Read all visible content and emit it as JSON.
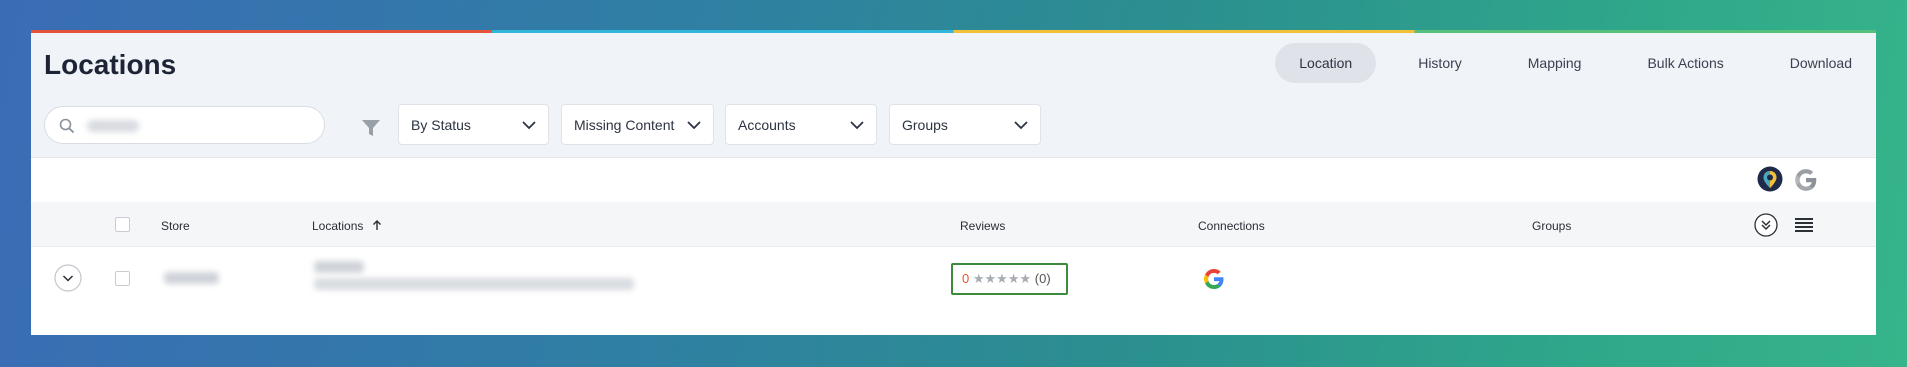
{
  "page": {
    "title": "Locations"
  },
  "nav": {
    "items": [
      {
        "label": "Location",
        "active": true
      },
      {
        "label": "History",
        "active": false
      },
      {
        "label": "Mapping",
        "active": false
      },
      {
        "label": "Bulk Actions",
        "active": false
      },
      {
        "label": "Download",
        "active": false
      }
    ]
  },
  "filters": {
    "search_value": "",
    "status_label": "By Status",
    "missing_label": "Missing Content",
    "accounts_label": "Accounts",
    "groups_label": "Groups"
  },
  "table": {
    "columns": {
      "store": "Store",
      "locations": "Locations",
      "reviews": "Reviews",
      "connections": "Connections",
      "groups": "Groups"
    },
    "rows": [
      {
        "reviews": {
          "score": "0",
          "stars": "★★★★★",
          "count": "(0)"
        },
        "connection": "google"
      }
    ]
  },
  "colors": {
    "accent_score": "#e8542c",
    "review_border": "#3c8a3a",
    "active_nav_bg": "#dfe3e9"
  }
}
